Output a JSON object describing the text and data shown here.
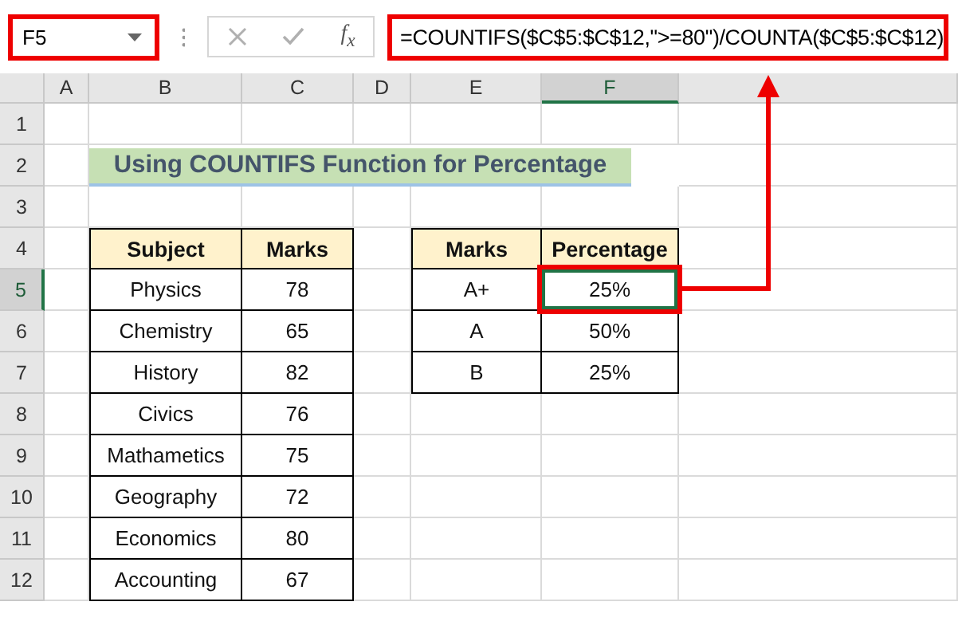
{
  "formula_bar": {
    "name_box": "F5",
    "function_label": "f$_{x}$",
    "formula": "=COUNTIFS($C$5:$C$12,\">=80\")/COUNTA($C$5:$C$12)"
  },
  "columns": [
    {
      "label": "A",
      "selected": false
    },
    {
      "label": "B",
      "selected": false
    },
    {
      "label": "C",
      "selected": false
    },
    {
      "label": "D",
      "selected": false
    },
    {
      "label": "E",
      "selected": false
    },
    {
      "label": "F",
      "selected": true
    }
  ],
  "rows": [
    {
      "label": "1",
      "selected": false
    },
    {
      "label": "2",
      "selected": false
    },
    {
      "label": "3",
      "selected": false
    },
    {
      "label": "4",
      "selected": false
    },
    {
      "label": "5",
      "selected": true
    },
    {
      "label": "6",
      "selected": false
    },
    {
      "label": "7",
      "selected": false
    },
    {
      "label": "8",
      "selected": false
    },
    {
      "label": "9",
      "selected": false
    },
    {
      "label": "10",
      "selected": false
    },
    {
      "label": "11",
      "selected": false
    },
    {
      "label": "12",
      "selected": false
    }
  ],
  "title": "Using COUNTIFS Function for Percentage",
  "marks_table": {
    "columns": [
      "Subject",
      "Marks"
    ],
    "rows": [
      [
        "Physics",
        "78"
      ],
      [
        "Chemistry",
        "65"
      ],
      [
        "History",
        "82"
      ],
      [
        "Civics",
        "76"
      ],
      [
        "Mathametics",
        "75"
      ],
      [
        "Geography",
        "72"
      ],
      [
        "Economics",
        "80"
      ],
      [
        "Accounting",
        "67"
      ]
    ]
  },
  "percentage_table": {
    "columns": [
      "Marks",
      "Percentage"
    ],
    "rows": [
      {
        "grade": "A+",
        "percentage": "25%",
        "selected": true
      },
      {
        "grade": "A",
        "percentage": "50%",
        "selected": false
      },
      {
        "grade": "B",
        "percentage": "25%",
        "selected": false
      }
    ]
  }
}
